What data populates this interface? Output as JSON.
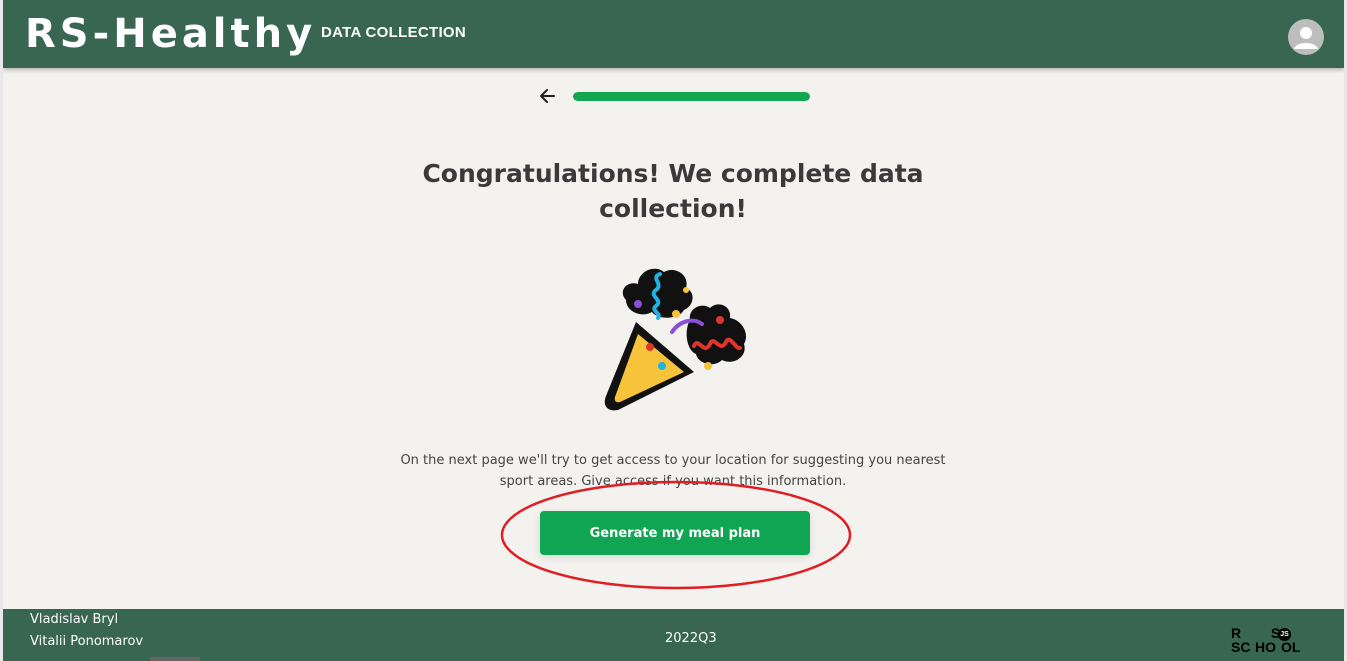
{
  "header": {
    "logo": "RS-Healthy",
    "section_title": "DATA COLLECTION",
    "avatar_icon": "person-icon"
  },
  "progress": {
    "back_icon": "arrow-left-icon",
    "value": 1.0,
    "color": "#12a650"
  },
  "main": {
    "headline": "Congratulations! We complete data collection!",
    "illustration_icon": "party-popper-icon",
    "info_line1": "On the next page we'll try to get access to your location for suggesting you nearest",
    "info_line2": "sport areas. Give access if you want this information.",
    "cta_label": "Generate my meal plan"
  },
  "footer": {
    "authors": [
      "Vladislav Bryl",
      "Vitalii Ponomarov"
    ],
    "year": "2022Q3",
    "school_logo": [
      "R",
      "S",
      "SC",
      "HO",
      "OL",
      "JS"
    ]
  },
  "colors": {
    "header_bg": "#386651",
    "page_bg": "#f3f2ef",
    "button_bg": "#0fa552",
    "annotation": "#e01e24"
  }
}
